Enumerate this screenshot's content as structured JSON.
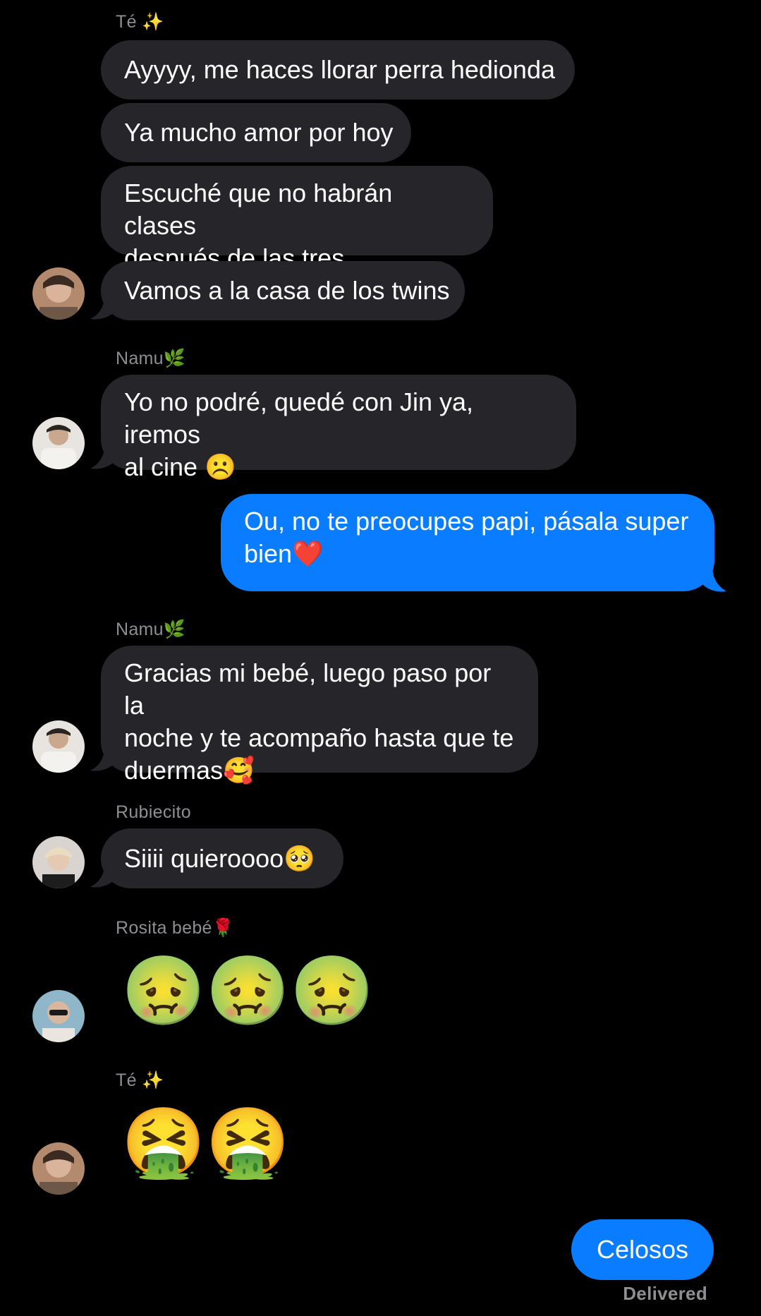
{
  "messages": [
    {
      "sender": "Té ✨"
    },
    {
      "text": "Ayyyy, me haces llorar perra hedionda"
    },
    {
      "text": "Ya mucho amor por hoy"
    },
    {
      "line1": "Escuché que no habrán clases",
      "line2": "después de las tres"
    },
    {
      "text": "Vamos a la casa de los twins"
    },
    {
      "sender": "Namu🌿"
    },
    {
      "line1": "Yo no podré, quedé con Jin ya, iremos",
      "line2": "al cine ☹️"
    },
    {
      "line1": "Ou, no te preocupes papi, pásala super",
      "line2": "bien❤️"
    },
    {
      "sender": "Namu🌿"
    },
    {
      "line1": "Gracias mi bebé, luego paso por la",
      "line2": "noche y te acompaño hasta que te",
      "line3": "duermas🥰"
    },
    {
      "sender": "Rubiecito"
    },
    {
      "text": "Siiii quieroooo🥺"
    },
    {
      "sender": "Rosita bebé🌹"
    },
    {
      "emojis": "🤢🤢🤢"
    },
    {
      "sender": "Té ✨"
    },
    {
      "emojis": "🤮🤮"
    },
    {
      "text": "Celosos"
    }
  ],
  "status": "Delivered",
  "colors": {
    "incoming": "#26252a",
    "outgoing": "#0a7cff",
    "background": "#000000"
  }
}
